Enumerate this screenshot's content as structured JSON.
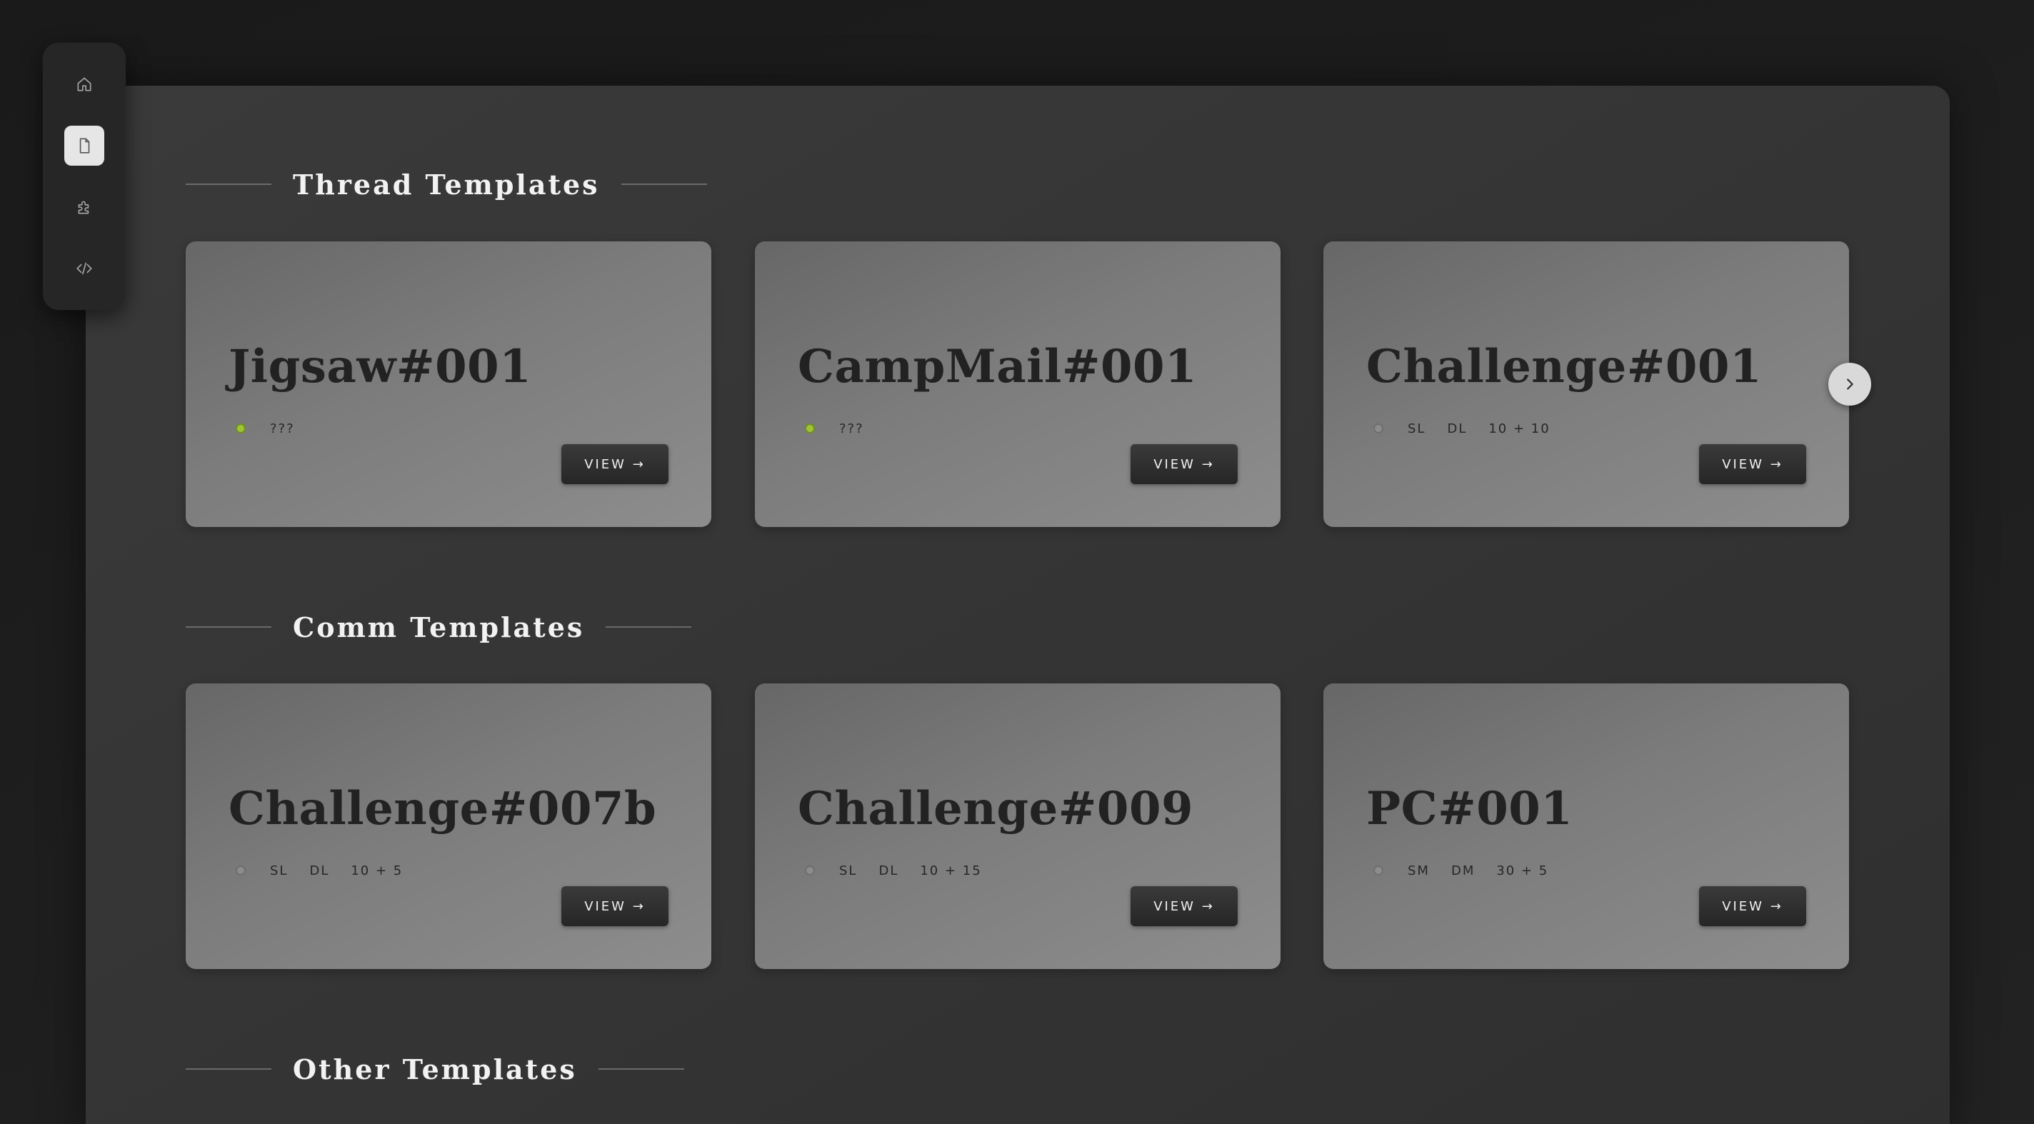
{
  "sidebar": {
    "items": [
      {
        "icon": "home-icon",
        "active": false
      },
      {
        "icon": "document-icon",
        "active": true
      },
      {
        "icon": "puzzle-icon",
        "active": false
      },
      {
        "icon": "code-icon",
        "active": false
      }
    ]
  },
  "sections": {
    "thread": {
      "title": "Thread Templates",
      "cards": [
        {
          "title": "Jigsaw#001",
          "status": "active",
          "meta": [
            "???"
          ],
          "button": "VIEW →"
        },
        {
          "title": "CampMail#001",
          "status": "active",
          "meta": [
            "???"
          ],
          "button": "VIEW →"
        },
        {
          "title": "Challenge#001",
          "status": "inactive",
          "meta": [
            "SL",
            "DL",
            "10 + 10"
          ],
          "button": "VIEW →"
        }
      ]
    },
    "comm": {
      "title": "Comm Templates",
      "cards": [
        {
          "title": "Challenge#007b",
          "status": "inactive",
          "meta": [
            "SL",
            "DL",
            "10 + 5"
          ],
          "button": "VIEW →"
        },
        {
          "title": "Challenge#009",
          "status": "inactive",
          "meta": [
            "SL",
            "DL",
            "10 + 15"
          ],
          "button": "VIEW →"
        },
        {
          "title": "PC#001",
          "status": "inactive",
          "meta": [
            "SM",
            "DM",
            "30 + 5"
          ],
          "button": "VIEW →"
        }
      ]
    },
    "other": {
      "title": "Other Templates"
    }
  },
  "colors": {
    "status_active": "#9fc23a",
    "status_inactive": "#8c8c8c"
  }
}
